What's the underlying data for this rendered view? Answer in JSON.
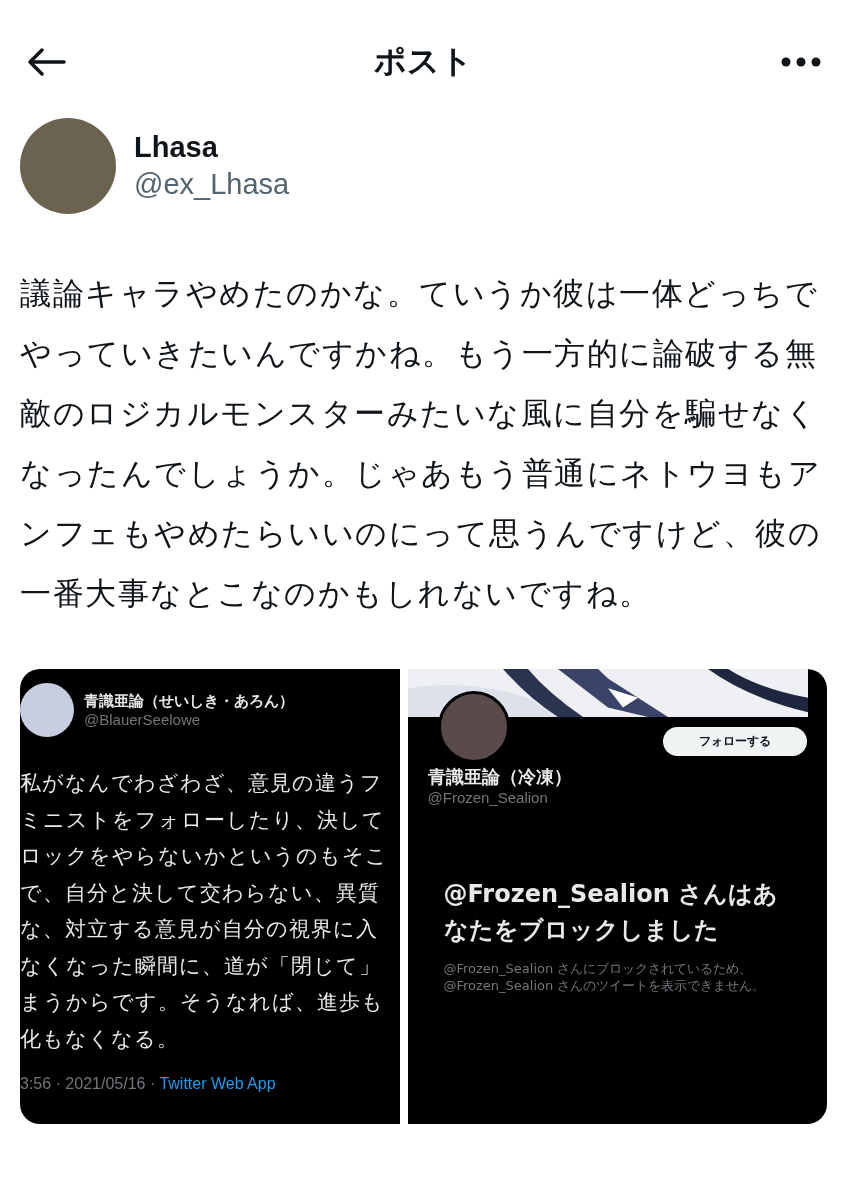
{
  "header": {
    "title": "ポスト"
  },
  "author": {
    "name": "Lhasa",
    "handle": "@ex_Lhasa"
  },
  "body": "議論キャラやめたのかな。ていうか彼は一体どっちでやっていきたいんですかね。もう一方的に論破する無敵のロジカルモンスターみたいな風に自分を騙せなくなったんでしょうか。じゃあもう普通にネトウヨもアンフェもやめたらいいのにって思うんですけど、彼の一番大事なとこなのかもしれないですね。",
  "images": [
    {
      "kind": "tweet",
      "name": "青識亜論（せいしき・あろん）",
      "handle": "@BlauerSeelowe",
      "lines": [
        "私がなんでわざわざ、意見の違うフ",
        "ミニストをフォローしたり、決して",
        "ロックをやらないかというのもそこ",
        "で、自分と決して交わらない、異質",
        "な、対立する意見が自分の視界に入",
        "なくなった瞬間に、道が「閉じて」",
        "まうからです。そうなれば、進歩も",
        "化もなくなる。"
      ],
      "meta": "3:56 · 2021/05/16 · ",
      "source": "Twitter Web App"
    },
    {
      "kind": "profile",
      "name": "青識亜論（冷凍）",
      "handle": "@Frozen_Sealion",
      "follow": "フォローする",
      "heading": "@Frozen_Sealion さんはあなたをブロックしました",
      "note": "@Frozen_Sealion さんにブロックされているため、@Frozen_Sealion さんのツイートを表示できません。"
    }
  ]
}
